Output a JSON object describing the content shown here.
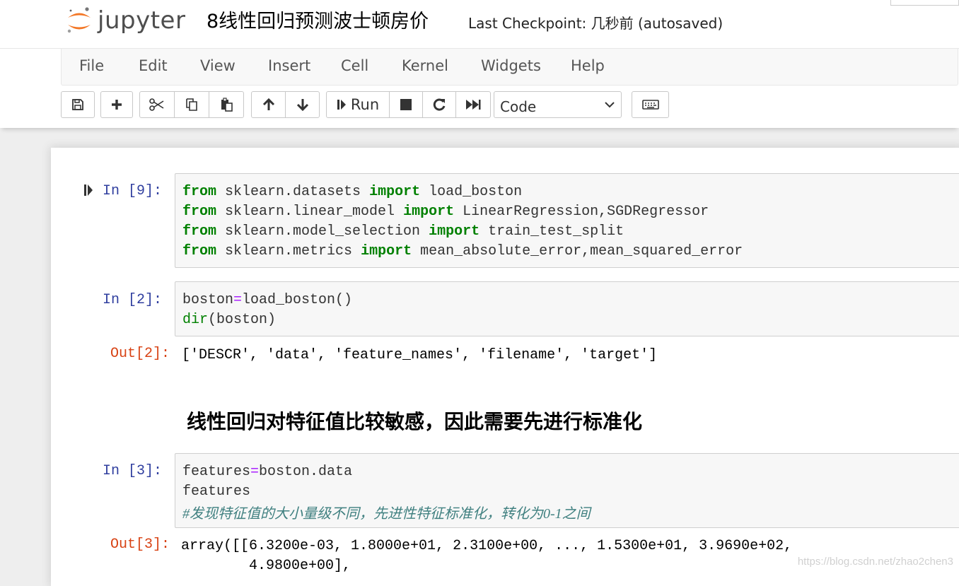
{
  "header": {
    "logo_text": "jupyter",
    "notebook_title": "8线性回归预测波士顿房价",
    "checkpoint_text": "Last Checkpoint: 几秒前   (autosaved)"
  },
  "menu": {
    "items": [
      "File",
      "Edit",
      "View",
      "Insert",
      "Cell",
      "Kernel",
      "Widgets",
      "Help"
    ]
  },
  "toolbar": {
    "save_icon": "save-icon",
    "add_icon": "plus-icon",
    "cut_icon": "scissors-icon",
    "copy_icon": "copy-icon",
    "paste_icon": "paste-icon",
    "move_up_icon": "arrow-up-icon",
    "move_down_icon": "arrow-down-icon",
    "run_label": "Run",
    "interrupt_icon": "stop-icon",
    "restart_icon": "restart-icon",
    "run_all_icon": "fast-forward-icon",
    "cell_type_value": "Code",
    "keyboard_icon": "keyboard-icon"
  },
  "cells": {
    "c9": {
      "prompt": "In  [9]:",
      "lines": [
        [
          "from",
          " sklearn.datasets ",
          "import",
          " load_boston"
        ],
        [
          "from",
          " sklearn.linear_model ",
          "import",
          " LinearRegression,SGDRegressor"
        ],
        [
          "from",
          " sklearn.model_selection ",
          "import",
          " train_test_split"
        ],
        [
          "from",
          " sklearn.metrics ",
          "import",
          " mean_absolute_error,mean_squared_error"
        ]
      ]
    },
    "c2": {
      "prompt": "In  [2]:",
      "line1": [
        "boston",
        "=",
        "load_boston()"
      ],
      "line2": [
        "dir",
        "(boston)"
      ],
      "out_prompt": "Out[2]:",
      "output": "['DESCR', 'data', 'feature_names', 'filename', 'target']"
    },
    "markdown": {
      "heading": "线性回归对特征值比较敏感，因此需要先进行标准化"
    },
    "c3": {
      "prompt": "In  [3]:",
      "line1": [
        "features",
        "=",
        "boston.data"
      ],
      "line2": "features",
      "comment": "#发现特征值的大小量级不同，先进性特征标准化，转化为0-1之间",
      "out_prompt": "Out[3]:",
      "output_line1": "array([[6.3200e-03, 1.8000e+01, 2.3100e+00, ..., 1.5300e+01, 3.9690e+02,",
      "output_line2": "        4.9800e+00],"
    }
  },
  "watermark": "https://blog.csdn.net/zhao2chen3"
}
